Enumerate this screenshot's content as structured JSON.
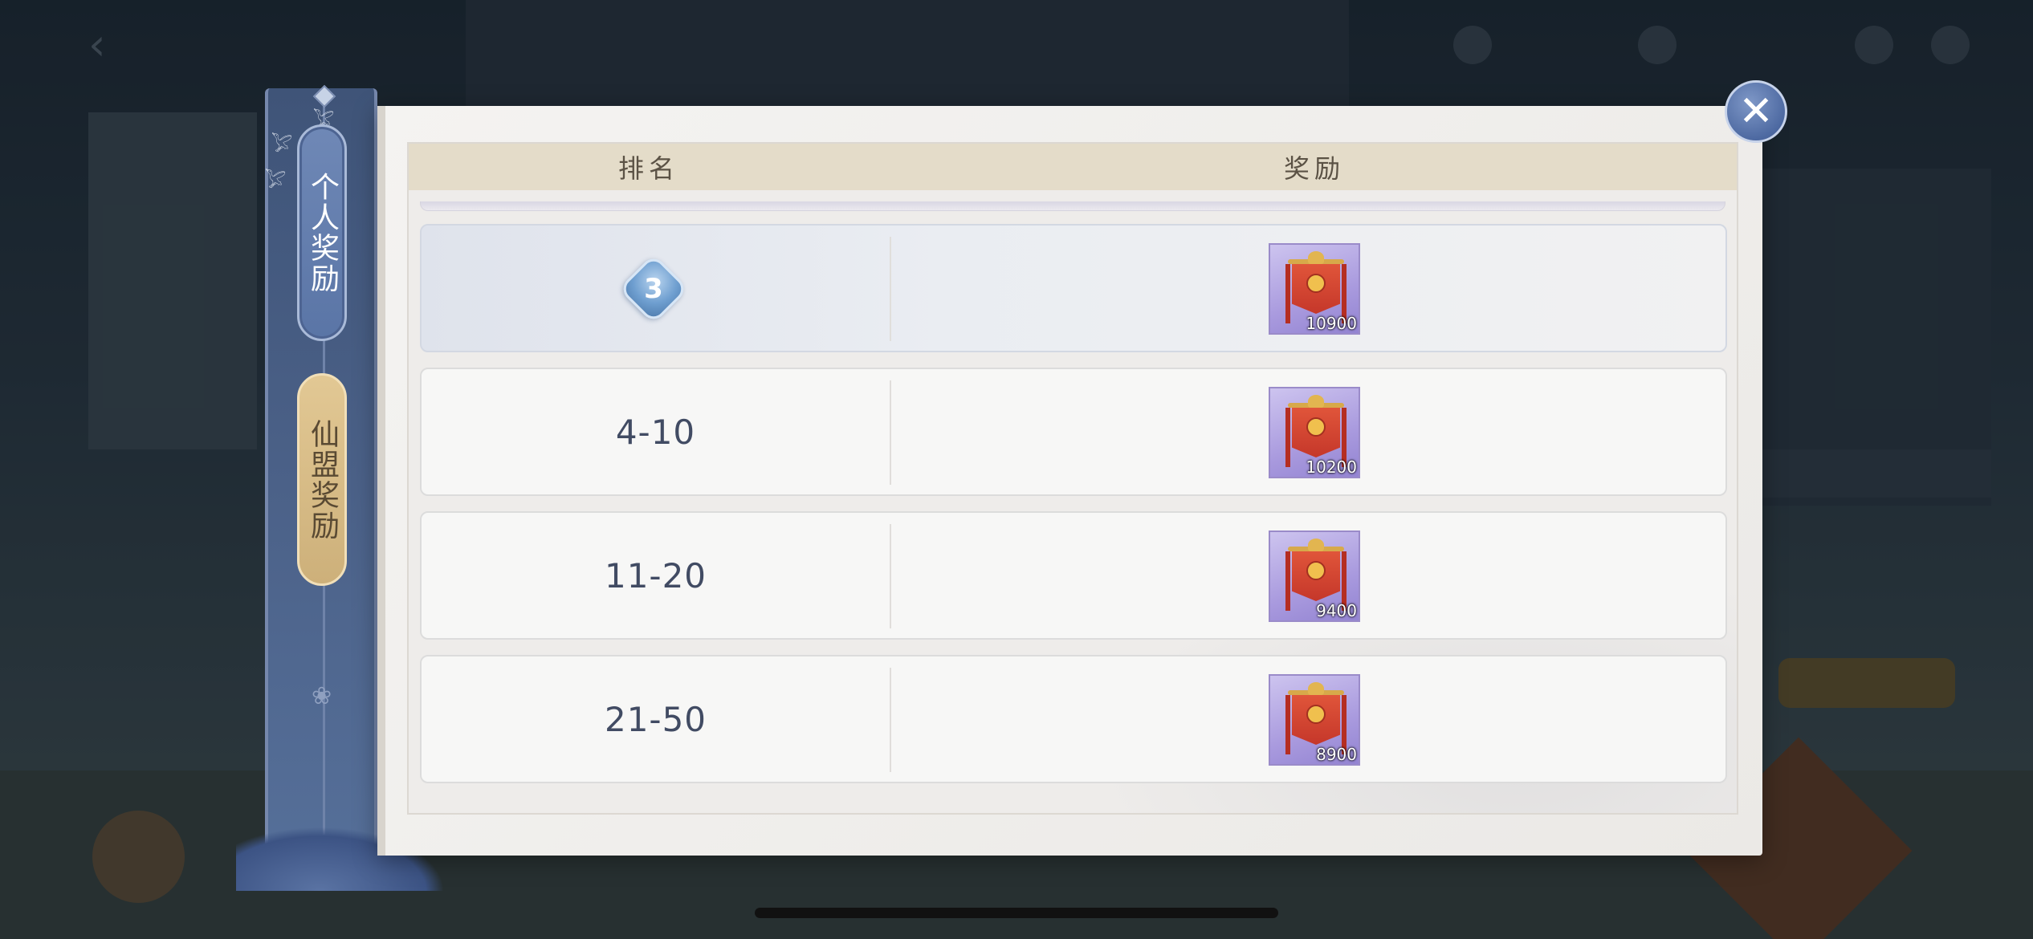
{
  "tabs": [
    {
      "label": "个人奖励",
      "active": true
    },
    {
      "label": "仙盟奖励",
      "active": false
    }
  ],
  "table": {
    "headers": {
      "rank": "排名",
      "reward": "奖励"
    },
    "rows": [
      {
        "rank": "3",
        "rank_style": "badge",
        "reward_icon": "banner-item-icon",
        "reward_qty": "10900"
      },
      {
        "rank": "4-10",
        "rank_style": "text",
        "reward_icon": "banner-item-icon",
        "reward_qty": "10200"
      },
      {
        "rank": "11-20",
        "rank_style": "text",
        "reward_icon": "banner-item-icon",
        "reward_qty": "9400"
      },
      {
        "rank": "21-50",
        "rank_style": "text",
        "reward_icon": "banner-item-icon",
        "reward_qty": "8900"
      }
    ]
  },
  "close_button": {
    "icon": "close-icon"
  },
  "colors": {
    "header_bg": "#e4dcc9",
    "active_tab": "#5a75a6",
    "inactive_tab": "#cdb07a",
    "item_frame": "#a99ade"
  }
}
